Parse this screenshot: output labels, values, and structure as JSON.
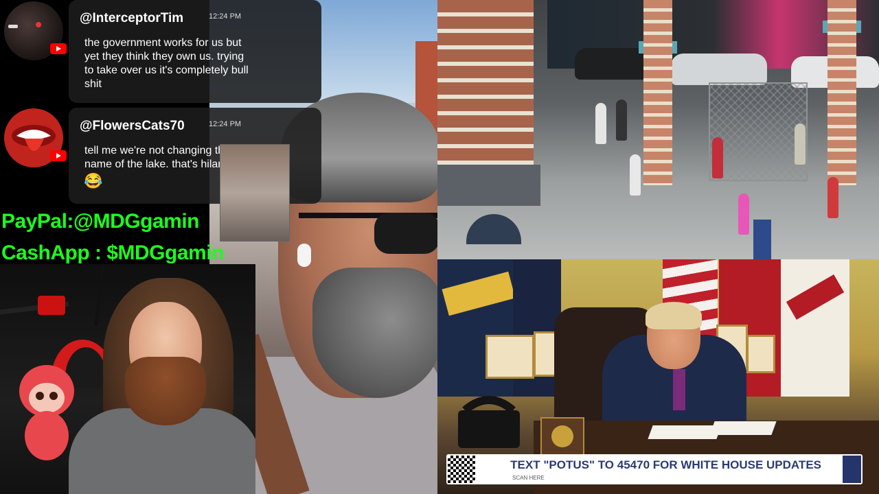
{
  "chat": {
    "messages": [
      {
        "username": "@InterceptorTim",
        "time": "12:24 PM",
        "text": "the government works for us but\nyet they think they own us. trying\nto take over us it's completely bull\nshit",
        "avatar_icon": "dark-street-avatar-icon",
        "platform_icon": "youtube-icon"
      },
      {
        "username": "@FlowersCats70",
        "time": "12:24 PM",
        "text": "tell me we're not changing the\nname of the lake. that's hilarious",
        "emoji": "😂",
        "avatar_icon": "rolling-stones-tongue-icon",
        "platform_icon": "youtube-icon"
      }
    ]
  },
  "donations": {
    "paypal": "PayPal:@MDGgamin",
    "cashapp": "CashApp : $MDGgamin"
  },
  "news": {
    "chyron": "TEXT \"POTUS\" TO 45470 FOR WHITE HOUSE UPDATES",
    "chyron_sub": "SCAN HERE"
  },
  "colors": {
    "donation_green": "#1cff1c",
    "chat_bg": "#1c1c1e",
    "youtube_red": "#ff0000",
    "chyron_text": "#2b3b73"
  }
}
